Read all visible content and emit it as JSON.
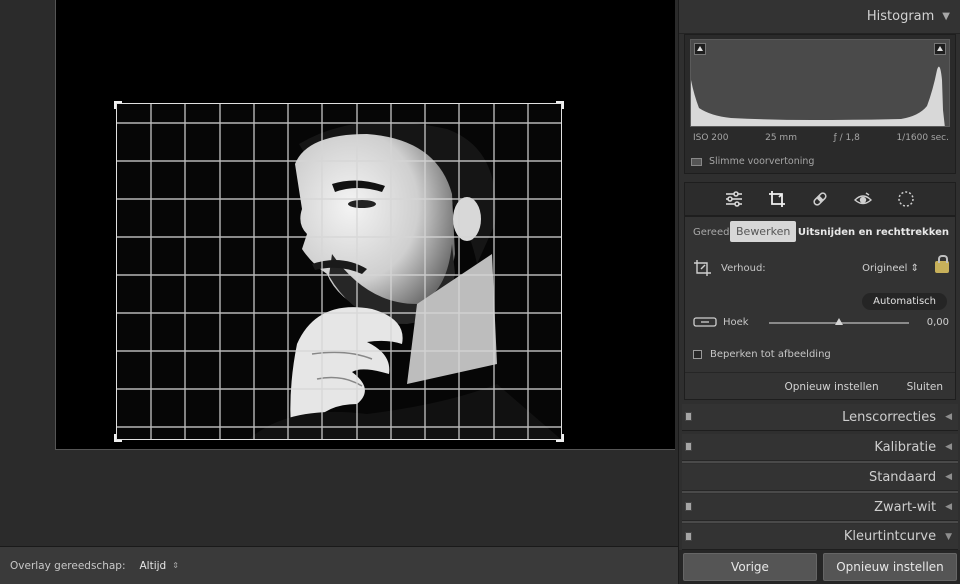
{
  "toolbar": {
    "overlay_label": "Overlay gereedschap:",
    "overlay_value": "Altijd"
  },
  "histogram": {
    "title": "Histogram",
    "iso": "ISO 200",
    "focal": "25 mm",
    "aperture": "ƒ / 1,8",
    "shutter": "1/1600 sec.",
    "smart_preview": "Slimme voorvertoning"
  },
  "tools": [
    "sliders-icon",
    "crop-icon",
    "healing-icon",
    "redeye-icon",
    "mask-icon"
  ],
  "crop": {
    "tools_label": "Gereedschap",
    "tooltip": "Bewerken",
    "title": "Uitsnijden en rechttrekken",
    "aspect_label": "Verhoud:",
    "aspect_value": "Origineel ⇕",
    "auto_label": "Automatisch",
    "angle_label": "Hoek",
    "angle_value": "0,00",
    "angle_fraction": 0.5,
    "constrain_label": "Beperken tot afbeelding",
    "reset_label": "Opnieuw instellen",
    "close_label": "Sluiten"
  },
  "sections": [
    "Lenscorrecties",
    "Kalibratie",
    "Standaard",
    "Zwart-wit",
    "Kleurtintcurve"
  ],
  "buttons": {
    "previous": "Vorige",
    "reset": "Opnieuw instellen"
  },
  "colors": {
    "accent_lock": "#c7b05a",
    "background": "#2f2f2f"
  }
}
